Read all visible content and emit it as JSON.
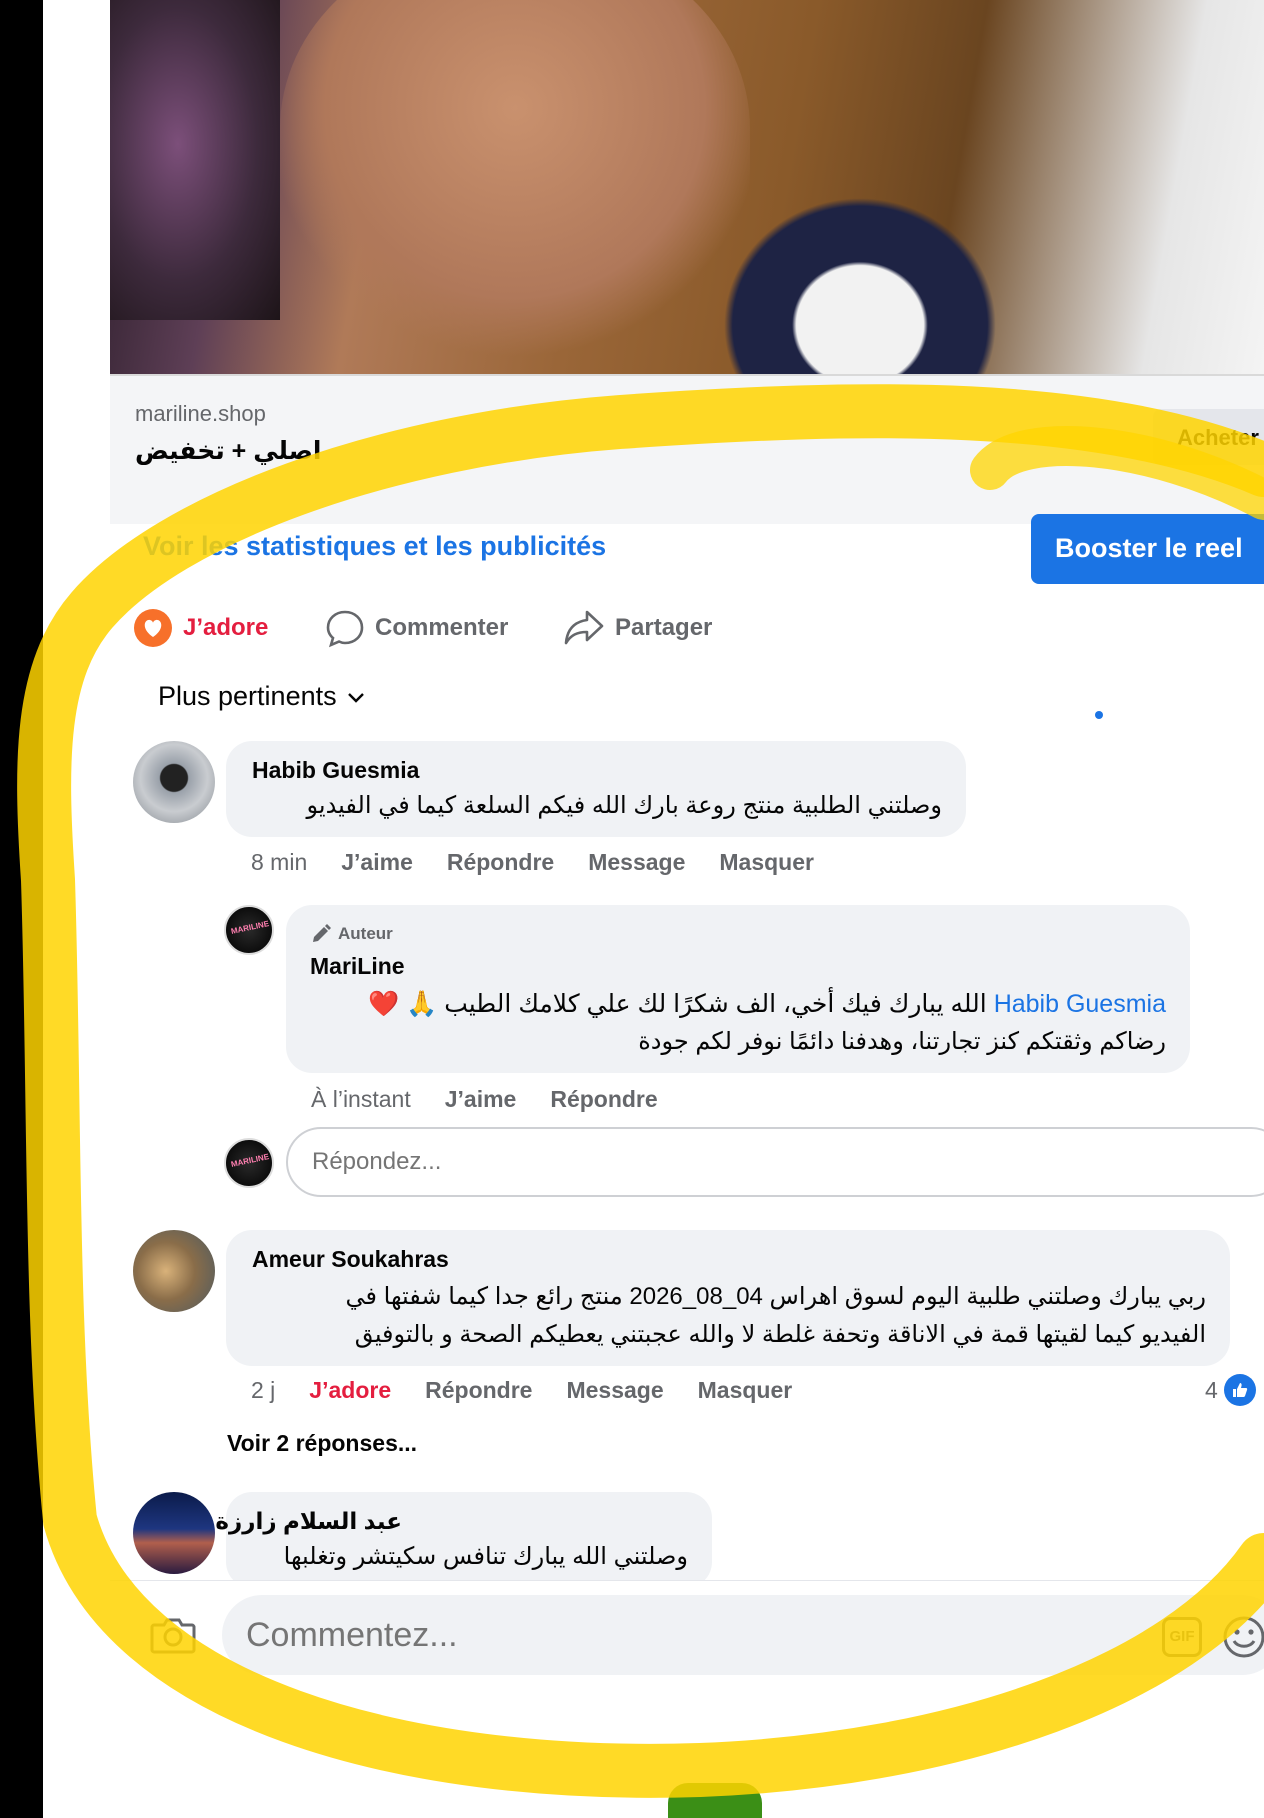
{
  "link_card": {
    "domain": "mariline.shop",
    "title": "اصلي + تخفيض",
    "buy_label": "Acheter"
  },
  "promo": {
    "stats_link": "Voir les statistiques et les publicités",
    "boost_label": "Booster le reel"
  },
  "actions": {
    "love": "J’adore",
    "comment": "Commenter",
    "share": "Partager"
  },
  "sort": {
    "label": "Plus pertinents"
  },
  "comments": [
    {
      "name": "Habib Guesmia",
      "text": "وصلتني الطلبية منتج روعة بارك الله فيكم السلعة كيما في الفيديو",
      "time": "8 min",
      "actions": [
        "J’aime",
        "Répondre",
        "Message",
        "Masquer"
      ]
    },
    {
      "badge": "Auteur",
      "name": "MariLine",
      "mention": "Habib Guesmia",
      "line1": "الله يبارك فيك أخي،  الف شكرًا لك علي كلامك الطيب 🙏 ❤️",
      "line2": "رضاكم وثقتكم كنز تجارتنا، وهدفنا دائمًا نوفر لكم جودة",
      "time": "À l’instant",
      "actions": [
        "J’aime",
        "Répondre"
      ]
    },
    {
      "name": "Ameur Soukahras",
      "line1": "ربي يبارك وصلتني طلبية اليوم لسوق اهراس 04_08_2026 منتج رائع جدا كيما شفتها في",
      "line2": "الفيديو كيما لقيتها قمة في الاناقة وتحفة غلطة لا والله عجبتني يعطيكم الصحة و بالتوفيق",
      "time": "2 j",
      "reaction": "J’adore",
      "actions": [
        "Répondre",
        "Message",
        "Masquer"
      ],
      "likes": "4",
      "see_replies": "Voir 2 réponses..."
    },
    {
      "name": "عبد السلام زارزة",
      "text": "وصلتني الله يبارك تنافس سكيتشر وتغلبها"
    }
  ],
  "reply_input": {
    "placeholder": "Répondez..."
  },
  "composer": {
    "placeholder": "Commentez...",
    "gif_label": "GIF"
  },
  "colors": {
    "accent_blue": "#1b74e4",
    "love_red": "#e41e3f",
    "highlight_yellow": "#ffd400"
  },
  "icons": [
    "heart-icon",
    "comment-icon",
    "share-icon",
    "chevron-down-icon",
    "pencil-icon",
    "thumbs-up-icon",
    "camera-icon",
    "gif-icon",
    "emoji-icon"
  ]
}
